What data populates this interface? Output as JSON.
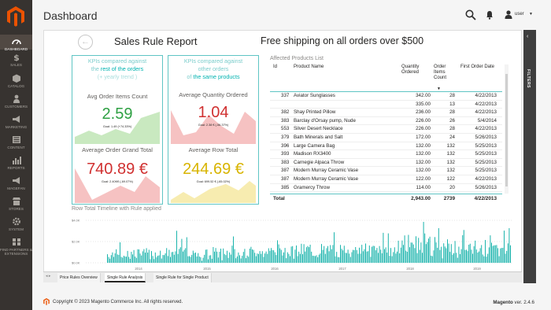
{
  "header": {
    "title": "Dashboard",
    "username": "user"
  },
  "sidebar": {
    "items": [
      {
        "label": "DASHBOARD",
        "icon": "dashboard-icon"
      },
      {
        "label": "SALES",
        "icon": "dollar-icon"
      },
      {
        "label": "CATALOG",
        "icon": "box-icon"
      },
      {
        "label": "CUSTOMERS",
        "icon": "person-icon"
      },
      {
        "label": "MARKETING",
        "icon": "megaphone-icon"
      },
      {
        "label": "CONTENT",
        "icon": "content-icon"
      },
      {
        "label": "REPORTS",
        "icon": "bar-chart-icon"
      },
      {
        "label": "MAGEFAN",
        "icon": "megaphone-icon"
      },
      {
        "label": "STORES",
        "icon": "store-icon"
      },
      {
        "label": "SYSTEM",
        "icon": "gear-icon"
      },
      {
        "label": "FIND PARTNERS & EXTENSIONS",
        "icon": "extensions-icon"
      }
    ]
  },
  "filters": {
    "label": "FILTERS"
  },
  "report": {
    "title": "Sales Rule Report",
    "promo": "Free shipping on all orders over $500",
    "kpi_left": {
      "head_line1": "KPIs compared against",
      "head_pre": "the ",
      "head_highlight": "rest of the orders",
      "head_paren": "(+ yearly trend )",
      "panel1": {
        "title": "Avg Order Items Count",
        "value": "2.59",
        "goal": "Goal: 1.49 (+74.33%)",
        "color": "#2ea043"
      },
      "panel2": {
        "title": "Average Order Grand Total",
        "value": "740.89 €",
        "goal": "Goal: 2.40K€ (-69.07%)",
        "color": "#d03030"
      }
    },
    "kpi_right": {
      "head_line1": "KPIs compared against",
      "head_line2": "other orders",
      "head_pre": "of ",
      "head_highlight": "the same products",
      "panel1": {
        "title": "Average Quantity Ordered",
        "value": "1.04",
        "goal": "Goal: 2.38 € (-56.37%)",
        "color": "#d03030"
      },
      "panel2": {
        "title": "Average Row Total",
        "value": "244.69 €",
        "goal": "Goal: 699.52 € (-65.02%)",
        "color": "#d8b400"
      }
    },
    "table": {
      "title": "Affected Products List",
      "headers": {
        "id": "Id",
        "name": "Product Name",
        "qty": "Quantity Ordered",
        "count": "Order Items Count",
        "date": "First Order Date"
      },
      "rows": [
        {
          "id": "337",
          "name": "Aviator Sunglasses",
          "qty": "342.00",
          "count": "28",
          "date": "4/22/2013"
        },
        {
          "id": "",
          "name": "",
          "qty": "335.00",
          "count": "13",
          "date": "4/22/2013"
        },
        {
          "id": "382",
          "name": "Shay Printed Pillow",
          "qty": "236.00",
          "count": "28",
          "date": "4/22/2013"
        },
        {
          "id": "383",
          "name": "Barclay d'Orsay pump, Nude",
          "qty": "226.00",
          "count": "26",
          "date": "5/4/2014"
        },
        {
          "id": "553",
          "name": "Silver Desert Necklace",
          "qty": "226.00",
          "count": "28",
          "date": "4/22/2013"
        },
        {
          "id": "379",
          "name": "Bath Minerals and Salt",
          "qty": "172.00",
          "count": "24",
          "date": "5/26/2013"
        },
        {
          "id": "396",
          "name": "Large Camera Bag",
          "qty": "132.00",
          "count": "132",
          "date": "5/25/2013"
        },
        {
          "id": "393",
          "name": "Madison RX3400",
          "qty": "132.00",
          "count": "132",
          "date": "5/25/2013"
        },
        {
          "id": "383",
          "name": "Carnegie Alpaca Throw",
          "qty": "132.00",
          "count": "132",
          "date": "5/25/2013"
        },
        {
          "id": "387",
          "name": "Modern Murray Ceramic Vase",
          "qty": "132.00",
          "count": "132",
          "date": "5/25/2013"
        },
        {
          "id": "387",
          "name": "Modern Murray Ceramic Vase",
          "qty": "122.00",
          "count": "122",
          "date": "4/22/2013"
        },
        {
          "id": "385",
          "name": "Gramercy Throw",
          "qty": "114.00",
          "count": "20",
          "date": "5/26/2013"
        }
      ],
      "total": {
        "label": "Total",
        "qty": "2,943.00",
        "count": "2739",
        "date": "4/22/2013"
      }
    },
    "timeline": {
      "title": "Row Total Timeline with Rule applied",
      "ylabels": [
        "$4.0K",
        "$2.0K",
        "$0.0K"
      ],
      "xlabels": [
        "2014",
        "2015",
        "2016",
        "2017",
        "2018",
        "2019"
      ]
    },
    "tabs": [
      "Price Rules Overview",
      "Single Rule Analysis",
      "Single Rule for Single Product"
    ],
    "active_tab": "Single Rule Analysis"
  },
  "footer": {
    "copyright": "Copyright © 2023 Magento Commerce Inc. All rights reserved.",
    "version_brand": "Magento",
    "version_text": "ver. 2.4.6"
  },
  "colors": {
    "sidebar": "#373330",
    "teal": "#5fc5c4",
    "green": "#2ea043",
    "red": "#d03030",
    "yellow": "#d8b400",
    "magento_orange": "#eb5202"
  }
}
